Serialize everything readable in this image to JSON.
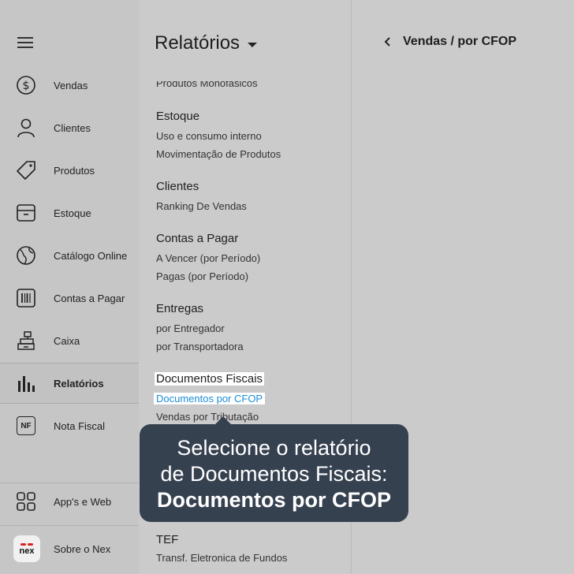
{
  "sidebar": {
    "items": [
      {
        "label": "Vendas",
        "icon": "dollar-circle-icon"
      },
      {
        "label": "Clientes",
        "icon": "user-icon"
      },
      {
        "label": "Produtos",
        "icon": "tag-icon"
      },
      {
        "label": "Estoque",
        "icon": "box-icon"
      },
      {
        "label": "Catálogo Online",
        "icon": "globe-icon"
      },
      {
        "label": "Contas a Pagar",
        "icon": "barcode-icon"
      },
      {
        "label": "Caixa",
        "icon": "cash-register-icon"
      },
      {
        "label": "Relatórios",
        "icon": "bar-chart-icon"
      },
      {
        "label": "Nota Fiscal",
        "icon": "nf-icon",
        "icon_text": "NF"
      }
    ],
    "apps_label": "App's e Web",
    "about_label": "Sobre o Nex",
    "logo_text": "nex"
  },
  "middle": {
    "title": "Relatórios",
    "partial_item": "Produtos Monofásicos",
    "sections": [
      {
        "title": "Estoque",
        "links": [
          "Uso e consumo interno",
          "Movimentação de Produtos"
        ]
      },
      {
        "title": "Clientes",
        "links": [
          "Ranking De Vendas"
        ]
      },
      {
        "title": "Contas a Pagar",
        "links": [
          "A Vencer (por Período)",
          "Pagas (por Período)"
        ]
      },
      {
        "title": "Entregas",
        "links": [
          "por Entregador",
          "por Transportadora"
        ]
      },
      {
        "title": "Documentos Fiscais",
        "links": [
          "Documentos por CFOP",
          "Vendas por Tributação"
        ]
      },
      {
        "title": "TEF",
        "links": [
          "Transf. Eletronica de Fundos"
        ]
      }
    ]
  },
  "right": {
    "breadcrumb": "Vendas / por CFOP"
  },
  "tooltip": {
    "line1": "Selecione o relatório",
    "line2": "de Documentos Fiscais:",
    "line3": "Documentos por CFOP"
  },
  "colors": {
    "tooltip_bg": "#364150",
    "highlight_link": "#1a8fd6",
    "brand_red": "#d22222"
  }
}
